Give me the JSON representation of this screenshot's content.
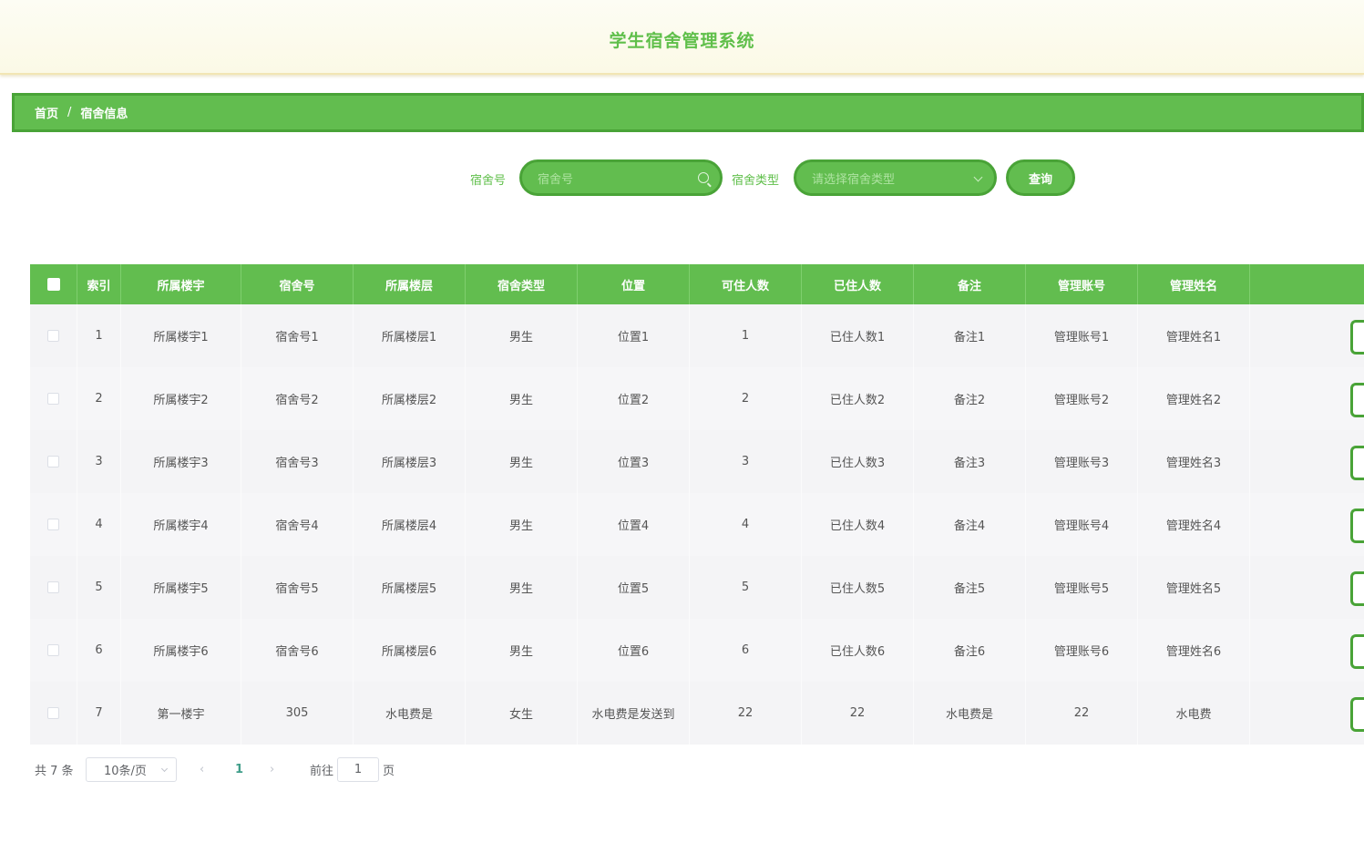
{
  "header": {
    "title": "学生宿舍管理系统"
  },
  "breadcrumb": {
    "home": "首页",
    "separator": "/",
    "current": "宿舍信息"
  },
  "search": {
    "room_label": "宿舍号",
    "room_placeholder": "宿舍号",
    "type_label": "宿舍类型",
    "type_placeholder": "请选择宿舍类型",
    "query_button": "查询"
  },
  "table": {
    "columns": [
      "索引",
      "所属楼宇",
      "宿舍号",
      "所属楼层",
      "宿舍类型",
      "位置",
      "可住人数",
      "已住人数",
      "备注",
      "管理账号",
      "管理姓名"
    ],
    "rows": [
      [
        "1",
        "所属楼宇1",
        "宿舍号1",
        "所属楼层1",
        "男生",
        "位置1",
        "1",
        "已住人数1",
        "备注1",
        "管理账号1",
        "管理姓名1"
      ],
      [
        "2",
        "所属楼宇2",
        "宿舍号2",
        "所属楼层2",
        "男生",
        "位置2",
        "2",
        "已住人数2",
        "备注2",
        "管理账号2",
        "管理姓名2"
      ],
      [
        "3",
        "所属楼宇3",
        "宿舍号3",
        "所属楼层3",
        "男生",
        "位置3",
        "3",
        "已住人数3",
        "备注3",
        "管理账号3",
        "管理姓名3"
      ],
      [
        "4",
        "所属楼宇4",
        "宿舍号4",
        "所属楼层4",
        "男生",
        "位置4",
        "4",
        "已住人数4",
        "备注4",
        "管理账号4",
        "管理姓名4"
      ],
      [
        "5",
        "所属楼宇5",
        "宿舍号5",
        "所属楼层5",
        "男生",
        "位置5",
        "5",
        "已住人数5",
        "备注5",
        "管理账号5",
        "管理姓名5"
      ],
      [
        "6",
        "所属楼宇6",
        "宿舍号6",
        "所属楼层6",
        "男生",
        "位置6",
        "6",
        "已住人数6",
        "备注6",
        "管理账号6",
        "管理姓名6"
      ],
      [
        "7",
        "第一楼宇",
        "305",
        "水电费是",
        "女生",
        "水电费是发送到",
        "22",
        "22",
        "水电费是",
        "22",
        "水电费"
      ]
    ]
  },
  "pagination": {
    "total": "共 7 条",
    "page_size": "10条/页",
    "prev": "‹",
    "current_page": "1",
    "next": "›",
    "goto_label": "前往",
    "goto_value": "1",
    "goto_suffix": "页"
  },
  "colors": {
    "accent": "#62bd4f",
    "accent_border": "#49a337",
    "title": "#5fbf4a"
  }
}
